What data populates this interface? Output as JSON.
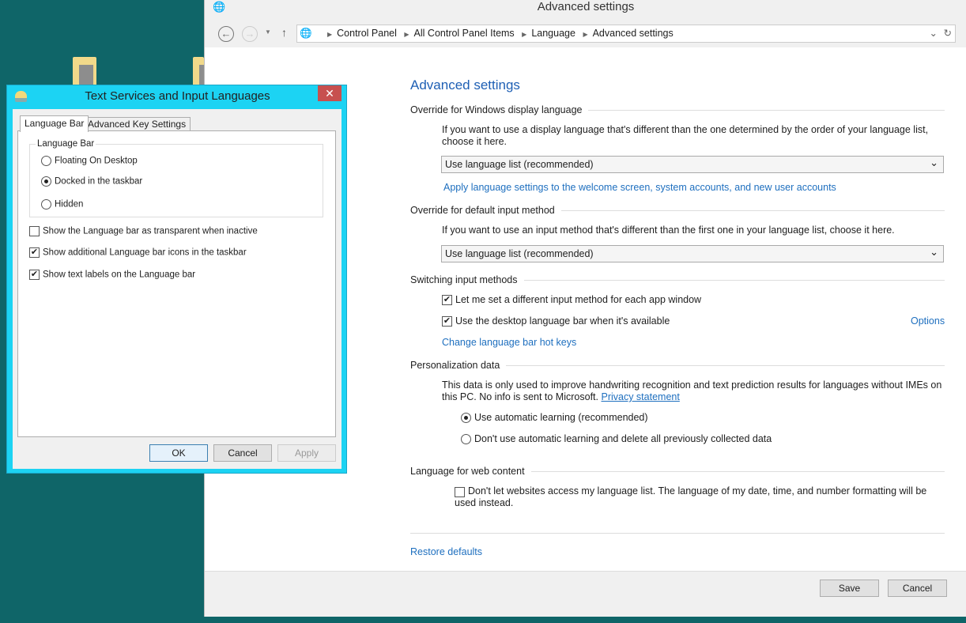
{
  "control_panel": {
    "title": "Advanced settings",
    "breadcrumb": [
      "Control Panel",
      "All Control Panel Items",
      "Language",
      "Advanced settings"
    ],
    "heading": "Advanced settings",
    "display_language": {
      "title": "Override for Windows display language",
      "desc": "If you want to use a display language that's different than the one determined by the order of your language list, choose it here.",
      "select": "Use language list (recommended)",
      "link": "Apply language settings to the welcome screen, system accounts, and new user accounts"
    },
    "input_method": {
      "title": "Override for default input method",
      "desc": "If you want to use an input method that's different than the first one in your language list, choose it here.",
      "select": "Use language list (recommended)"
    },
    "switching": {
      "title": "Switching input methods",
      "opt1": "Let me set a different input method for each app window",
      "opt1_checked": true,
      "opt2": "Use the desktop language bar when it's available",
      "opt2_checked": true,
      "options_link": "Options",
      "hotkeys_link": "Change language bar hot keys"
    },
    "personalization": {
      "title": "Personalization data",
      "desc": "This data is only used to improve handwriting recognition and text prediction results for languages without IMEs on this PC. No info is sent to Microsoft.",
      "privacy_link": "Privacy statement",
      "radio1": "Use automatic learning (recommended)",
      "radio2": "Don't use automatic learning and delete all previously collected data",
      "selected": "radio1"
    },
    "web_content": {
      "title": "Language for web content",
      "opt": "Don't let websites access my language list. The language of my date, time, and number formatting will be used instead.",
      "checked": false
    },
    "restore": "Restore defaults",
    "save": "Save",
    "cancel": "Cancel"
  },
  "dialog": {
    "title": "Text Services and Input Languages",
    "close": "✕",
    "tabs": [
      "Language Bar",
      "Advanced Key Settings"
    ],
    "group": "Language Bar",
    "radios": [
      "Floating On Desktop",
      "Docked in the taskbar",
      "Hidden"
    ],
    "selected_radio": 1,
    "checks": [
      {
        "label": "Show the Language bar as transparent when inactive",
        "checked": false
      },
      {
        "label": "Show additional Language bar icons in the taskbar",
        "checked": true
      },
      {
        "label": "Show text labels on the Language bar",
        "checked": true
      }
    ],
    "ok": "OK",
    "cancel": "Cancel",
    "apply": "Apply"
  }
}
